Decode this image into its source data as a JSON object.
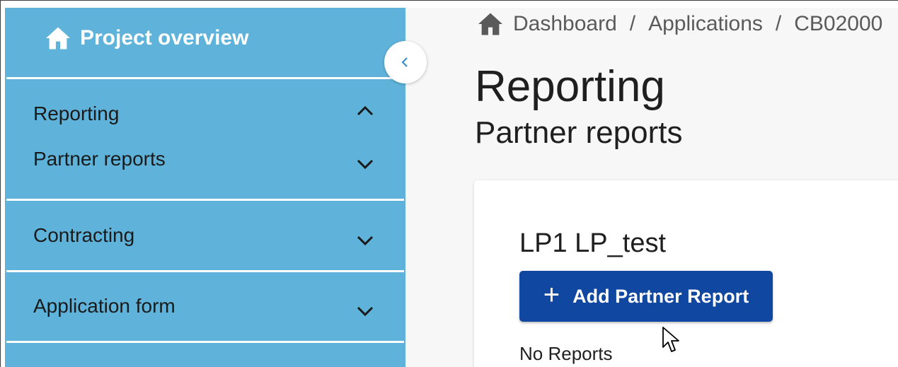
{
  "sidebar": {
    "home_label": "Project overview",
    "sections": [
      {
        "label": "Reporting",
        "expanded": true
      },
      {
        "label": "Partner reports",
        "expanded": false
      },
      {
        "label": "Contracting",
        "expanded": false
      },
      {
        "label": "Application form",
        "expanded": false
      }
    ],
    "background_color": "#5fb3da"
  },
  "breadcrumb": {
    "items": [
      "Dashboard",
      "Applications",
      "CB02000"
    ],
    "separator": "/"
  },
  "main": {
    "title": "Reporting",
    "subtitle": "Partner reports"
  },
  "card": {
    "partner_name": "LP1 LP_test",
    "add_button": {
      "label": "Add Partner Report",
      "icon": "plus-icon",
      "color": "#0f47a1"
    },
    "empty_text": "No Reports"
  },
  "icons": {
    "home": "home-icon",
    "collapse": "chevron-left-icon",
    "expand": "chevron-down-icon",
    "collapse_section": "chevron-up-icon"
  }
}
